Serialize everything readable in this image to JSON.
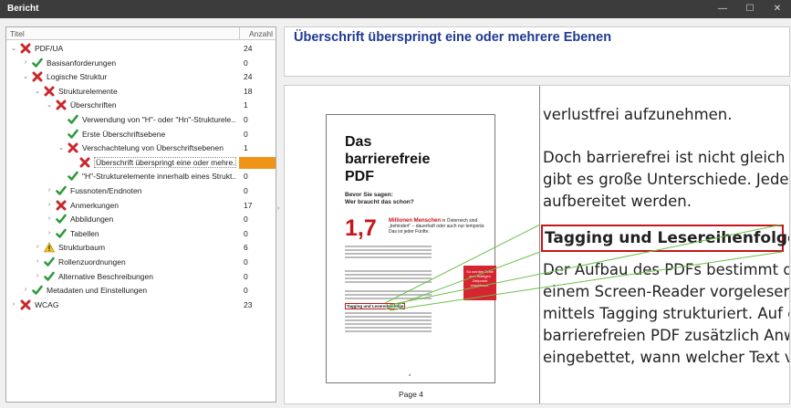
{
  "window": {
    "title": "Bericht",
    "minimize": "—",
    "maximize": "☐",
    "close": "✕"
  },
  "tree": {
    "col_title": "Titel",
    "col_count": "Anzahl",
    "rows": [
      {
        "label": "PDF/UA",
        "count": "24",
        "level": 0,
        "status": "fail",
        "expander": "open"
      },
      {
        "label": "Basisanforderungen",
        "count": "0",
        "level": 1,
        "status": "pass",
        "expander": "closed"
      },
      {
        "label": "Logische Struktur",
        "count": "24",
        "level": 1,
        "status": "fail",
        "expander": "open"
      },
      {
        "label": "Strukturelemente",
        "count": "18",
        "level": 2,
        "status": "fail",
        "expander": "open"
      },
      {
        "label": "Überschriften",
        "count": "1",
        "level": 3,
        "status": "fail",
        "expander": "open"
      },
      {
        "label": "Verwendung von \"H\"- oder \"Hn\"-Strukturele...",
        "count": "0",
        "level": 4,
        "status": "pass",
        "expander": "none"
      },
      {
        "label": "Erste Überschriftsebene",
        "count": "0",
        "level": 4,
        "status": "pass",
        "expander": "none"
      },
      {
        "label": "Verschachtelung von Überschriftsebenen",
        "count": "1",
        "level": 4,
        "status": "fail",
        "expander": "open"
      },
      {
        "label": "Überschrift überspringt eine oder mehre...",
        "count": "",
        "level": 5,
        "status": "fail",
        "expander": "none",
        "selected": true
      },
      {
        "label": "\"H\"-Strukturelemente innerhalb eines Strukt...",
        "count": "0",
        "level": 4,
        "status": "pass",
        "expander": "none"
      },
      {
        "label": "Fussnoten/Endnoten",
        "count": "0",
        "level": 3,
        "status": "pass",
        "expander": "closed"
      },
      {
        "label": "Anmerkungen",
        "count": "17",
        "level": 3,
        "status": "fail",
        "expander": "closed"
      },
      {
        "label": "Abbildungen",
        "count": "0",
        "level": 3,
        "status": "pass",
        "expander": "closed"
      },
      {
        "label": "Tabellen",
        "count": "0",
        "level": 3,
        "status": "pass",
        "expander": "closed"
      },
      {
        "label": "Strukturbaum",
        "count": "6",
        "level": 2,
        "status": "warn",
        "expander": "closed"
      },
      {
        "label": "Rollenzuordnungen",
        "count": "0",
        "level": 2,
        "status": "pass",
        "expander": "closed"
      },
      {
        "label": "Alternative Beschreibungen",
        "count": "0",
        "level": 2,
        "status": "pass",
        "expander": "closed"
      },
      {
        "label": "Metadaten und Einstellungen",
        "count": "0",
        "level": 1,
        "status": "pass",
        "expander": "closed"
      },
      {
        "label": "WCAG",
        "count": "23",
        "level": 0,
        "status": "fail",
        "expander": "closed"
      }
    ]
  },
  "detail": {
    "heading": "Überschrift überspringt eine oder mehrere Ebenen"
  },
  "preview": {
    "page_label": "Page 4",
    "doc_title_1": "Das",
    "doc_title_2": "barrierefreie",
    "doc_title_3": "PDF",
    "doc_sub_1": "Bevor Sie sagen:",
    "doc_sub_2": "Wer braucht das schon?",
    "doc_big": "1,7",
    "doc_big_red": "Millionen Menschen",
    "doc_big_rest": "in Österreich sind „behindert“ – dauerhaft oder auch nur temporär. Das ist jeder Fünfte.",
    "doc_redbox": "So werden Texte zum richtigen Zeitpunkt vorgelesen.",
    "doc_tag_small": "Tagging und Lesereihenfolge",
    "doc_pagenum": "4",
    "zoom_lines": [
      "verlustfrei aufzunehmen.",
      "Doch barrierefrei ist nicht gleich b",
      "gibt es große Unterschiede. Jedes",
      "aufbereitet werden.",
      "Der Aufbau des PDFs bestimmt di",
      "einem Screen-Reader vorgelesen",
      "mittels Tagging strukturiert. Auf d",
      "barrierefreien PDF zusätzlich Anw",
      "eingebettet, wann welcher Text vo"
    ],
    "zoom_tag": "Tagging und Lesereihenfolge"
  }
}
